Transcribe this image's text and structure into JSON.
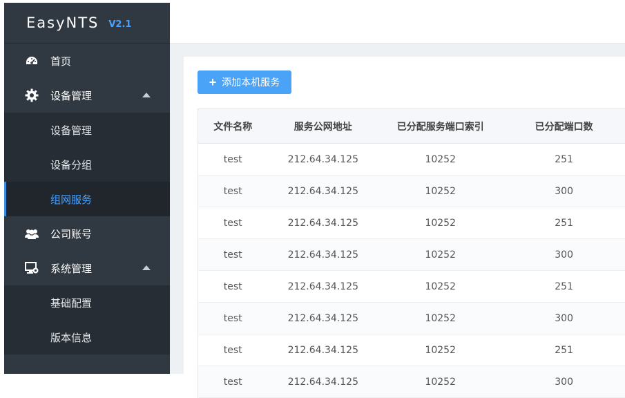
{
  "brand": {
    "name": "EasyNTS",
    "version": "V2.1"
  },
  "sidebar": {
    "items": [
      {
        "label": "首页",
        "icon": "dashboard-icon"
      },
      {
        "label": "设备管理",
        "icon": "gear-icon",
        "expanded": true,
        "children": [
          {
            "label": "设备管理"
          },
          {
            "label": "设备分组"
          },
          {
            "label": "组网服务",
            "active": true
          }
        ]
      },
      {
        "label": "公司账号",
        "icon": "users-icon"
      },
      {
        "label": "系统管理",
        "icon": "system-settings-icon",
        "expanded": true,
        "children": [
          {
            "label": "基础配置"
          },
          {
            "label": "版本信息"
          }
        ]
      }
    ]
  },
  "main": {
    "add_button_label": "添加本机服务",
    "table": {
      "headers": [
        "文件名称",
        "服务公网地址",
        "已分配服务端口索引",
        "已分配端口数"
      ],
      "rows": [
        [
          "test",
          "212.64.34.125",
          "10252",
          "251"
        ],
        [
          "test",
          "212.64.34.125",
          "10252",
          "300"
        ],
        [
          "test",
          "212.64.34.125",
          "10252",
          "251"
        ],
        [
          "test",
          "212.64.34.125",
          "10252",
          "300"
        ],
        [
          "test",
          "212.64.34.125",
          "10252",
          "251"
        ],
        [
          "test",
          "212.64.34.125",
          "10252",
          "300"
        ],
        [
          "test",
          "212.64.34.125",
          "10252",
          "251"
        ],
        [
          "test",
          "212.64.34.125",
          "10252",
          "300"
        ]
      ]
    }
  },
  "colors": {
    "sidebar_bg": "#303841",
    "accent": "#4aa3ff",
    "button": "#4aa3f6"
  }
}
